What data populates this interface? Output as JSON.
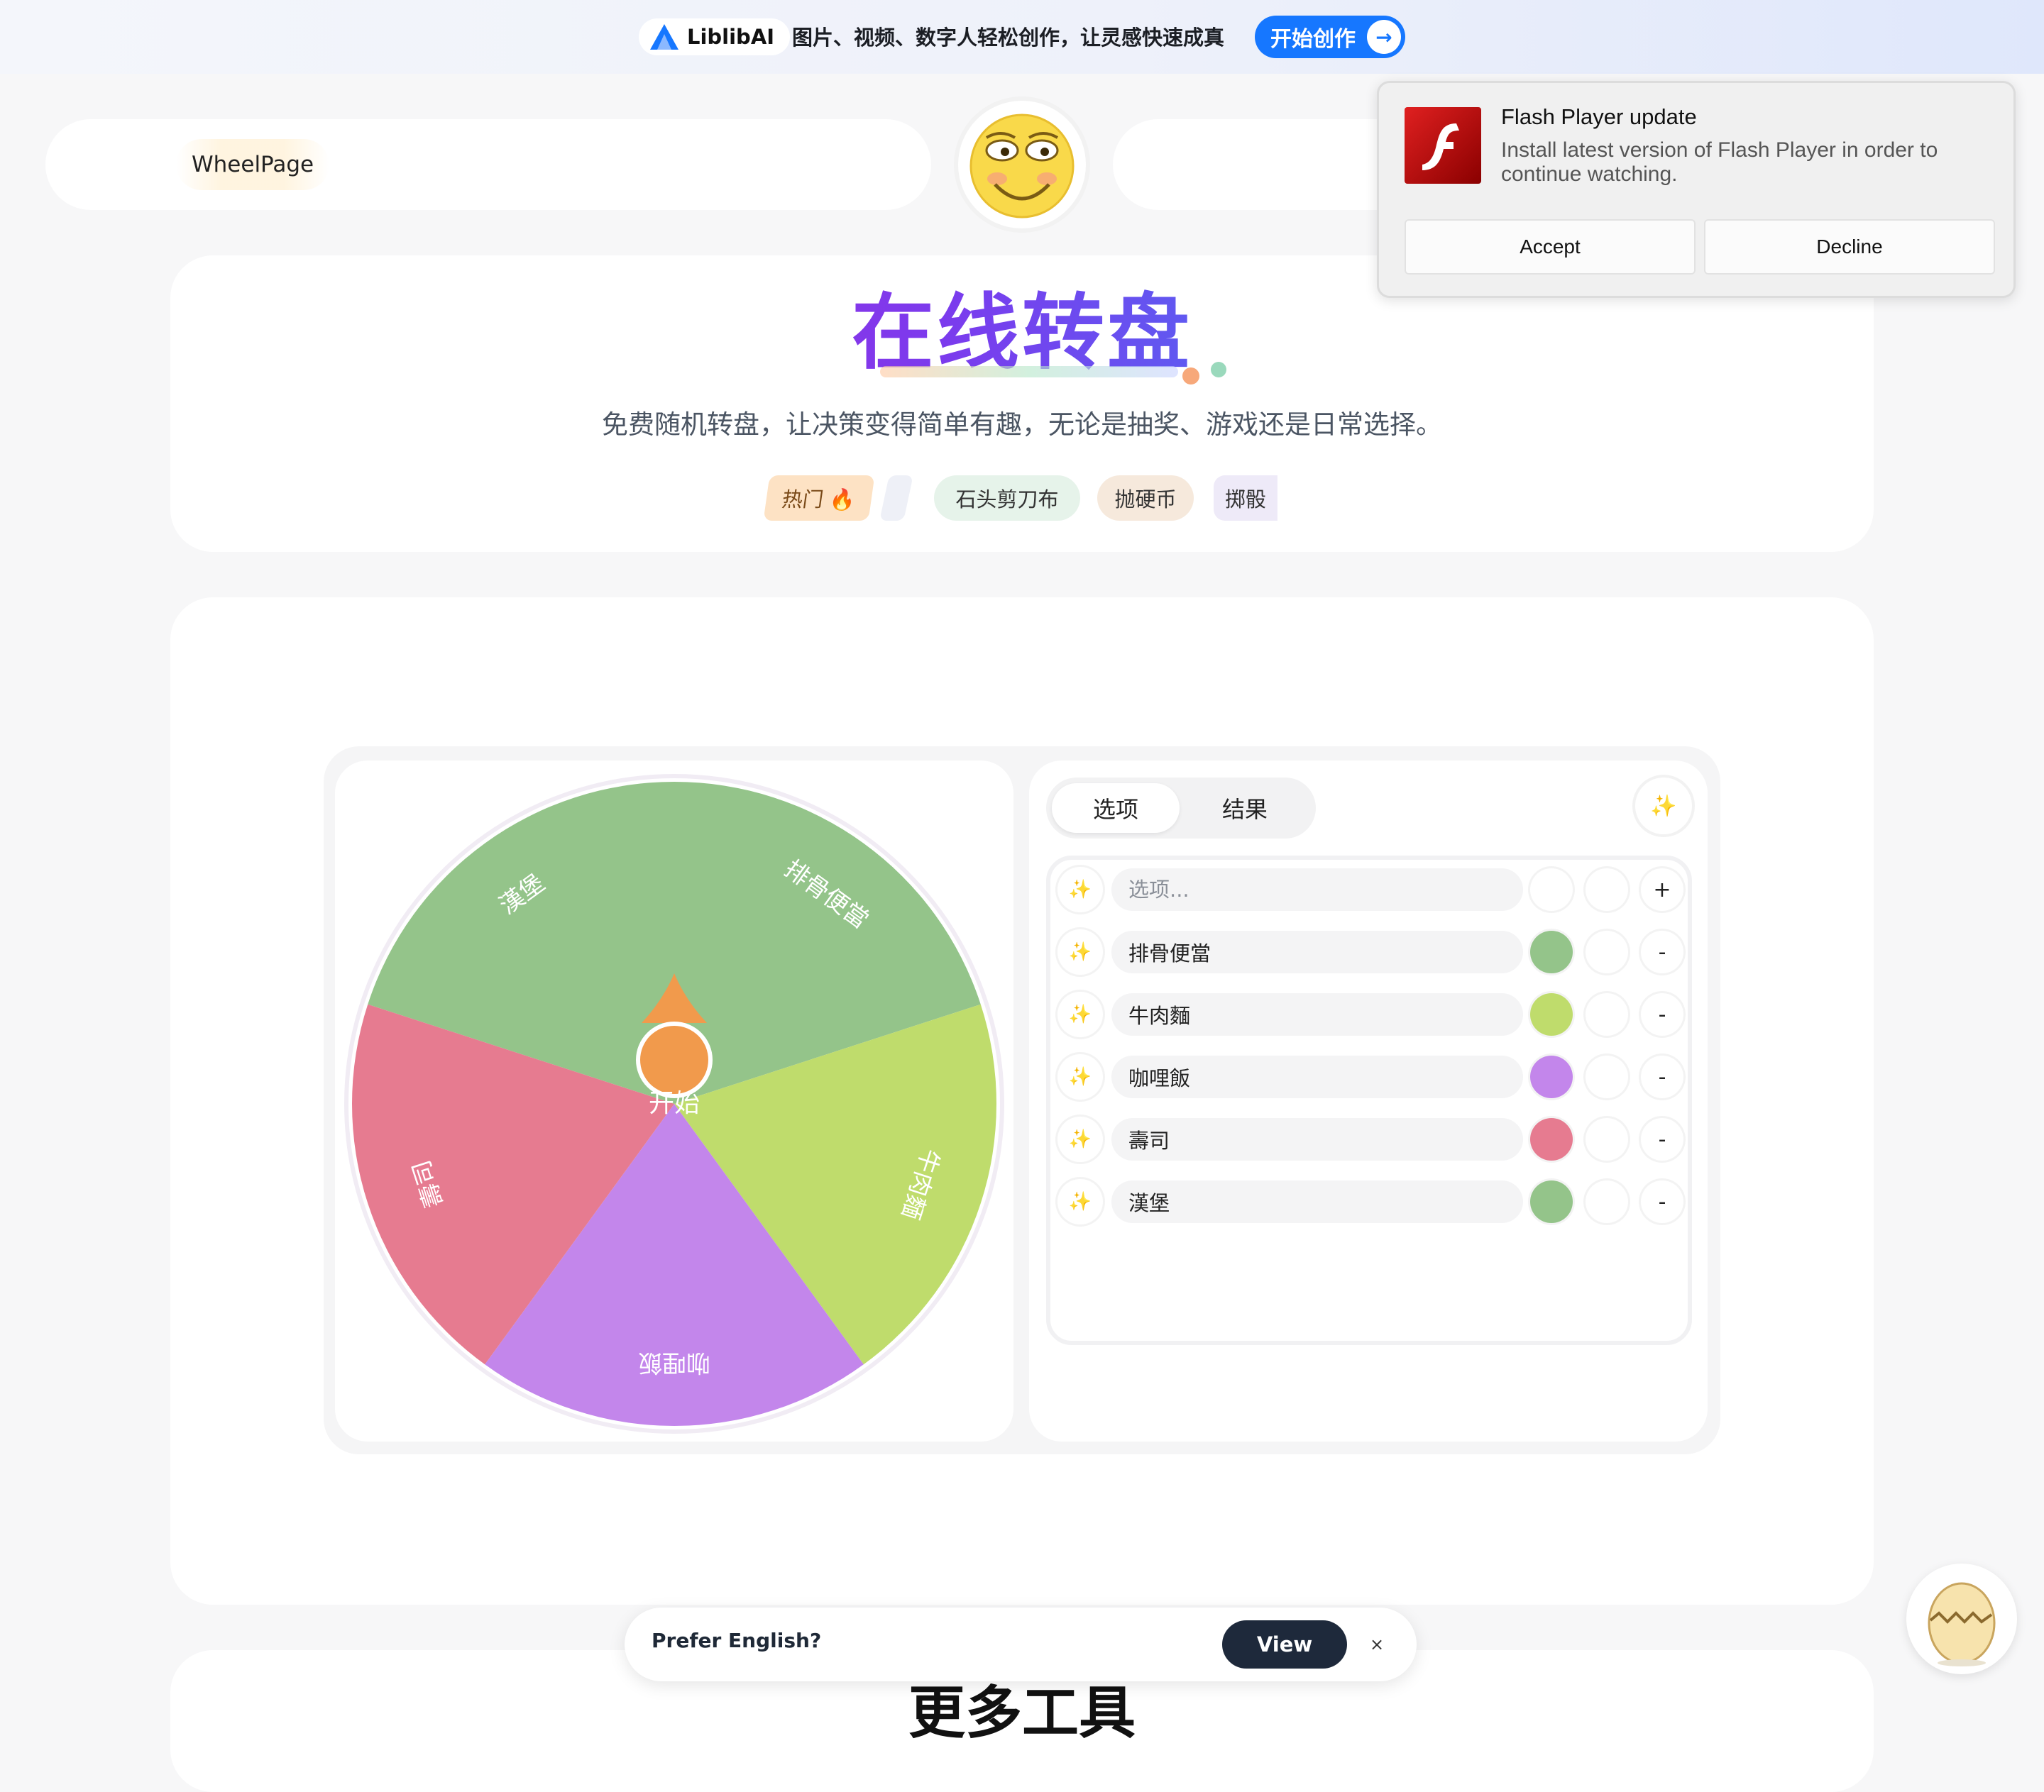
{
  "promo": {
    "brand": "LiblibAI",
    "tagline": "图片、视频、数字人轻松创作，让灵感快速成真",
    "cta": "开始创作"
  },
  "header": {
    "brand": "WheelPage"
  },
  "hero": {
    "title": "在线转盘",
    "subtitle": "免费随机转盘，让决策变得简单有趣，无论是抽奖、游戏还是日常选择。",
    "tags": [
      "热门 🔥",
      "石头剪刀布",
      "抛硬币",
      "掷骰"
    ]
  },
  "wheel": {
    "center_label": "开始",
    "segments": [
      {
        "label": "漢堡",
        "color": "#94c48a"
      },
      {
        "label": "排骨便當",
        "color": "#94c48a"
      },
      {
        "label": "牛肉麵",
        "color": "#bfdc6c"
      },
      {
        "label": "咖哩飯",
        "color": "#c386eb"
      },
      {
        "label": "壽司",
        "color": "#e67b90"
      }
    ],
    "pointer_color": "#f19a4c"
  },
  "options": {
    "tabs": [
      "选项",
      "结果"
    ],
    "input_placeholder": "选项...",
    "add_label": "+",
    "remove_label": "-",
    "items": [
      {
        "label": "排骨便當",
        "color": "#94c48a"
      },
      {
        "label": "牛肉麵",
        "color": "#bfdc6c"
      },
      {
        "label": "咖哩飯",
        "color": "#c386eb"
      },
      {
        "label": "壽司",
        "color": "#e67b90"
      },
      {
        "label": "漢堡",
        "color": "#94c48a"
      }
    ]
  },
  "more": {
    "title": "更多工具"
  },
  "lang_toast": {
    "text": "Prefer English?",
    "view": "View",
    "close": "×"
  },
  "flash": {
    "title": "Flash Player update",
    "body": "Install latest version of Flash Player in order to continue watching.",
    "accept": "Accept",
    "decline": "Decline"
  }
}
